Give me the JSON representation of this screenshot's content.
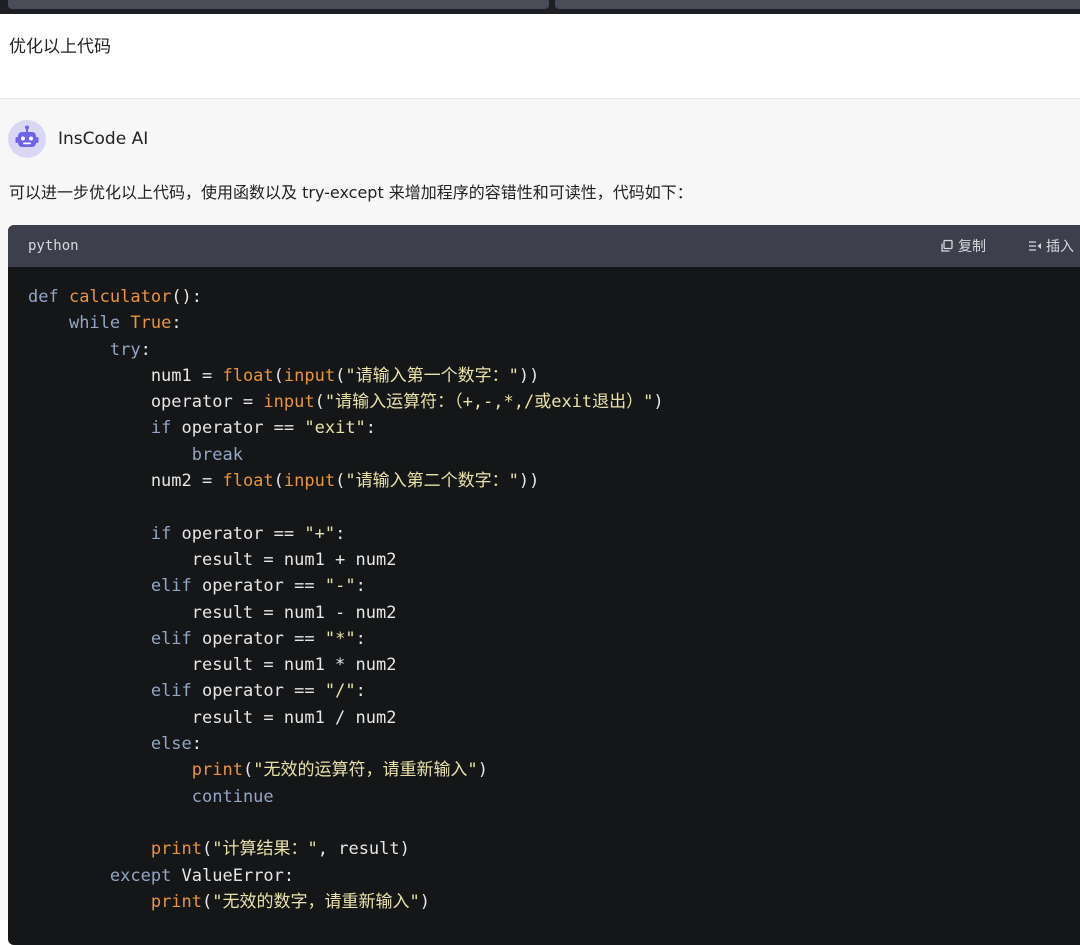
{
  "user_message": {
    "text": "优化以上代码"
  },
  "ai_response": {
    "name": "InsCode AI",
    "avatar_icon": "robot-icon",
    "intro": "可以进一步优化以上代码，使用函数以及 try-except 来增加程序的容错性和可读性，代码如下：",
    "code_block": {
      "language": "python",
      "copy_label": "复制",
      "insert_label": "插入",
      "lines": [
        [
          {
            "t": "kw",
            "s": "def "
          },
          {
            "t": "fn",
            "s": "calculator"
          },
          {
            "t": "plain",
            "s": "():"
          }
        ],
        [
          {
            "t": "plain",
            "s": "    "
          },
          {
            "t": "kw",
            "s": "while "
          },
          {
            "t": "fn",
            "s": "True"
          },
          {
            "t": "plain",
            "s": ":"
          }
        ],
        [
          {
            "t": "plain",
            "s": "        "
          },
          {
            "t": "kw",
            "s": "try"
          },
          {
            "t": "plain",
            "s": ":"
          }
        ],
        [
          {
            "t": "plain",
            "s": "            num1 = "
          },
          {
            "t": "fn",
            "s": "float"
          },
          {
            "t": "plain",
            "s": "("
          },
          {
            "t": "fn",
            "s": "input"
          },
          {
            "t": "plain",
            "s": "("
          },
          {
            "t": "str",
            "s": "\"请输入第一个数字：\""
          },
          {
            "t": "plain",
            "s": "))"
          }
        ],
        [
          {
            "t": "plain",
            "s": "            operator = "
          },
          {
            "t": "fn",
            "s": "input"
          },
          {
            "t": "plain",
            "s": "("
          },
          {
            "t": "str",
            "s": "\"请输入运算符：（+,-,*,/或exit退出）\""
          },
          {
            "t": "plain",
            "s": ")"
          }
        ],
        [
          {
            "t": "plain",
            "s": "            "
          },
          {
            "t": "kw",
            "s": "if "
          },
          {
            "t": "plain",
            "s": "operator == "
          },
          {
            "t": "str",
            "s": "\"exit\""
          },
          {
            "t": "plain",
            "s": ":"
          }
        ],
        [
          {
            "t": "plain",
            "s": "                "
          },
          {
            "t": "kw",
            "s": "break"
          }
        ],
        [
          {
            "t": "plain",
            "s": "            num2 = "
          },
          {
            "t": "fn",
            "s": "float"
          },
          {
            "t": "plain",
            "s": "("
          },
          {
            "t": "fn",
            "s": "input"
          },
          {
            "t": "plain",
            "s": "("
          },
          {
            "t": "str",
            "s": "\"请输入第二个数字：\""
          },
          {
            "t": "plain",
            "s": "))"
          }
        ],
        [],
        [
          {
            "t": "plain",
            "s": "            "
          },
          {
            "t": "kw",
            "s": "if "
          },
          {
            "t": "plain",
            "s": "operator == "
          },
          {
            "t": "str",
            "s": "\"+\""
          },
          {
            "t": "plain",
            "s": ":"
          }
        ],
        [
          {
            "t": "plain",
            "s": "                result = num1 + num2"
          }
        ],
        [
          {
            "t": "plain",
            "s": "            "
          },
          {
            "t": "kw",
            "s": "elif "
          },
          {
            "t": "plain",
            "s": "operator == "
          },
          {
            "t": "str",
            "s": "\"-\""
          },
          {
            "t": "plain",
            "s": ":"
          }
        ],
        [
          {
            "t": "plain",
            "s": "                result = num1 - num2"
          }
        ],
        [
          {
            "t": "plain",
            "s": "            "
          },
          {
            "t": "kw",
            "s": "elif "
          },
          {
            "t": "plain",
            "s": "operator == "
          },
          {
            "t": "str",
            "s": "\"*\""
          },
          {
            "t": "plain",
            "s": ":"
          }
        ],
        [
          {
            "t": "plain",
            "s": "                result = num1 * num2"
          }
        ],
        [
          {
            "t": "plain",
            "s": "            "
          },
          {
            "t": "kw",
            "s": "elif "
          },
          {
            "t": "plain",
            "s": "operator == "
          },
          {
            "t": "str",
            "s": "\"/\""
          },
          {
            "t": "plain",
            "s": ":"
          }
        ],
        [
          {
            "t": "plain",
            "s": "                result = num1 / num2"
          }
        ],
        [
          {
            "t": "plain",
            "s": "            "
          },
          {
            "t": "kw",
            "s": "else"
          },
          {
            "t": "plain",
            "s": ":"
          }
        ],
        [
          {
            "t": "plain",
            "s": "                "
          },
          {
            "t": "fn",
            "s": "print"
          },
          {
            "t": "plain",
            "s": "("
          },
          {
            "t": "str",
            "s": "\"无效的运算符，请重新输入\""
          },
          {
            "t": "plain",
            "s": ")"
          }
        ],
        [
          {
            "t": "plain",
            "s": "                "
          },
          {
            "t": "kw",
            "s": "continue"
          }
        ],
        [],
        [
          {
            "t": "plain",
            "s": "            "
          },
          {
            "t": "fn",
            "s": "print"
          },
          {
            "t": "plain",
            "s": "("
          },
          {
            "t": "str",
            "s": "\"计算结果：\""
          },
          {
            "t": "plain",
            "s": ", result)"
          }
        ],
        [
          {
            "t": "plain",
            "s": "        "
          },
          {
            "t": "kw",
            "s": "except "
          },
          {
            "t": "plain",
            "s": "ValueError:"
          }
        ],
        [
          {
            "t": "plain",
            "s": "            "
          },
          {
            "t": "fn",
            "s": "print"
          },
          {
            "t": "plain",
            "s": "("
          },
          {
            "t": "str",
            "s": "\"无效的数字，请重新输入\""
          },
          {
            "t": "plain",
            "s": ")"
          }
        ]
      ]
    }
  },
  "colors": {
    "code_background": "#151618",
    "code_header": "#3d3f4d",
    "keyword": "#93a6c5",
    "function": "#e8953c",
    "string": "#e8e1a8",
    "text": "#e6e6e6"
  }
}
